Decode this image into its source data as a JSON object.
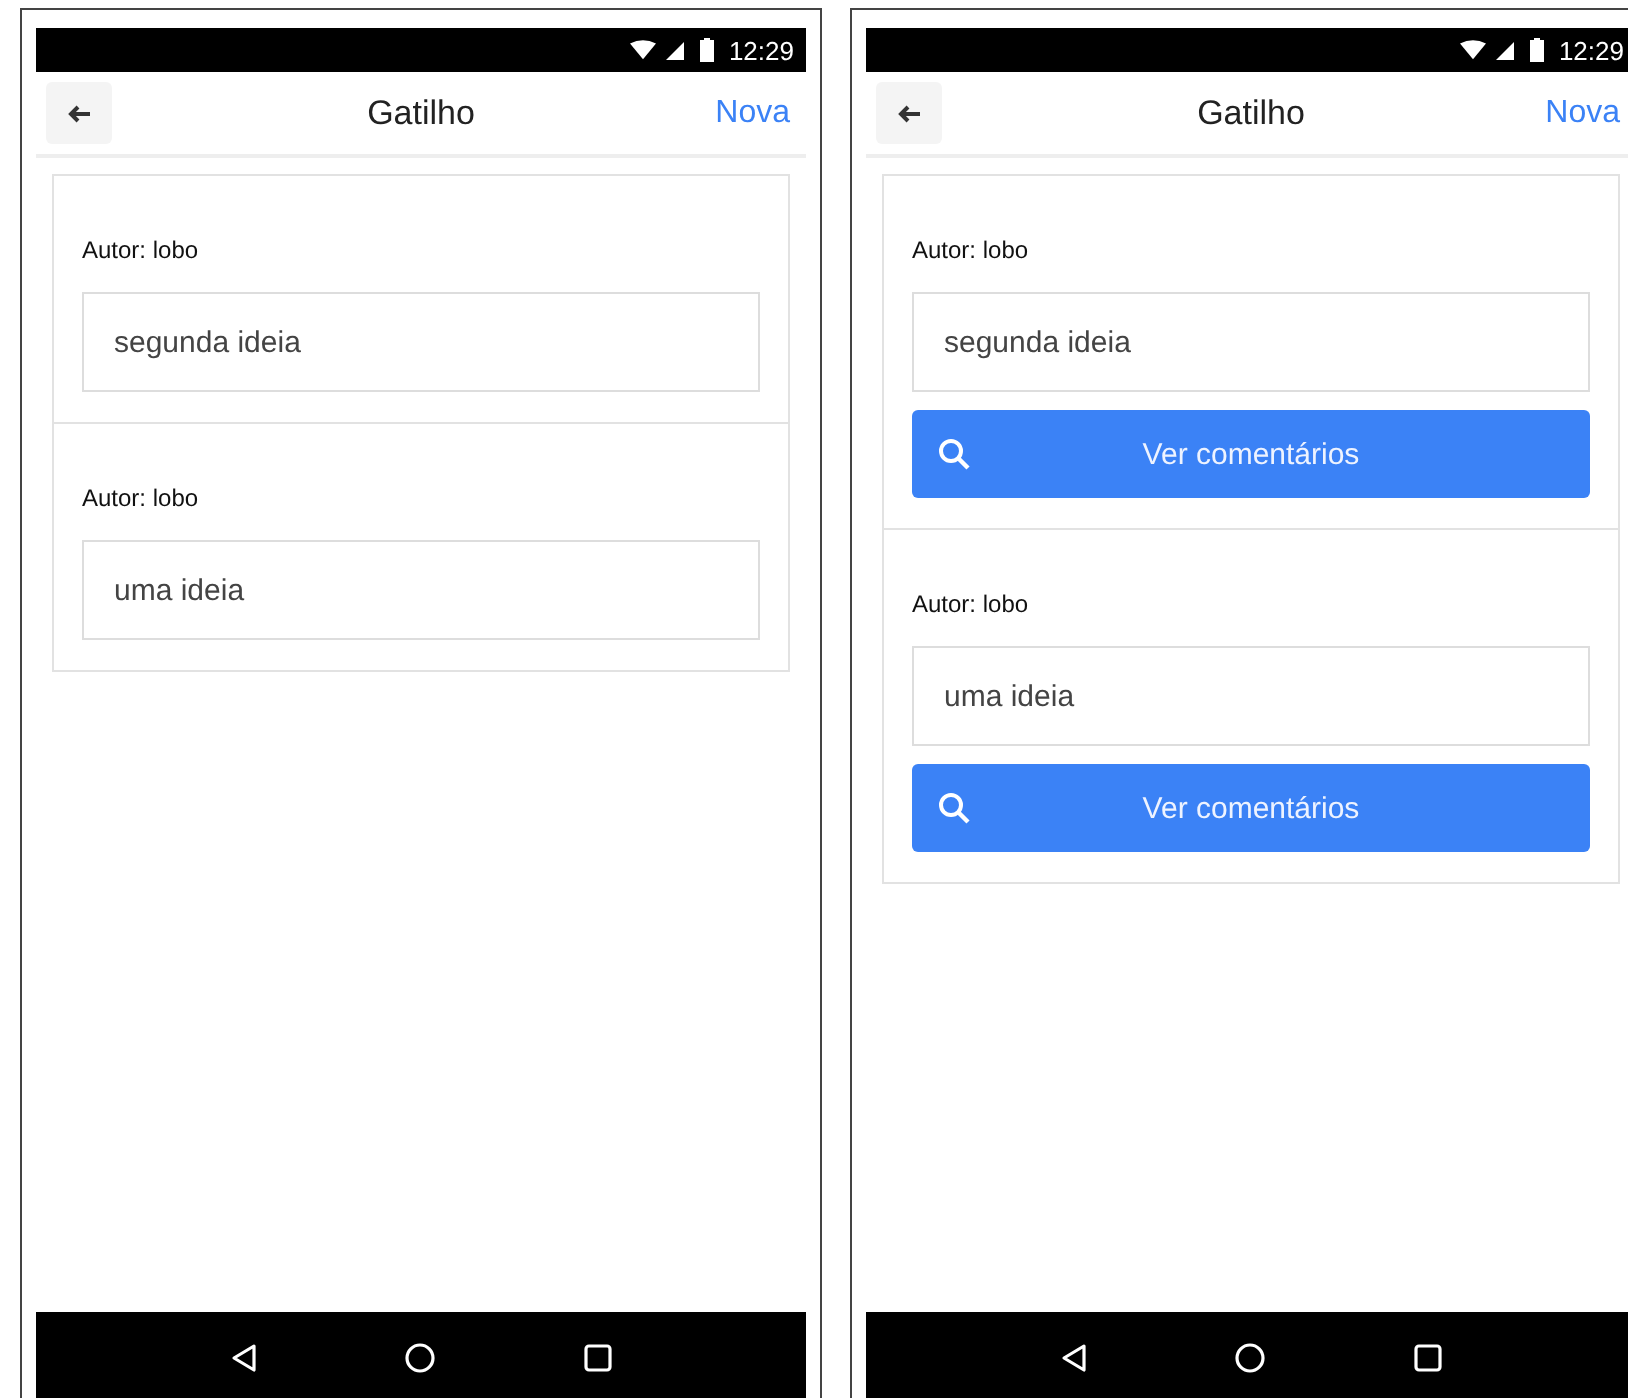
{
  "screens": [
    {
      "status_time": "12:29",
      "header": {
        "title": "Gatilho",
        "action": "Nova"
      },
      "posts": [
        {
          "author": "Autor: lobo",
          "text": "segunda ideia"
        },
        {
          "author": "Autor: lobo",
          "text": "uma ideia"
        }
      ]
    },
    {
      "status_time": "12:29",
      "header": {
        "title": "Gatilho",
        "action": "Nova"
      },
      "posts": [
        {
          "author": "Autor: lobo",
          "text": "segunda ideia",
          "button": "Ver comentários"
        },
        {
          "author": "Autor: lobo",
          "text": "uma ideia",
          "button": "Ver comentários"
        }
      ]
    }
  ]
}
